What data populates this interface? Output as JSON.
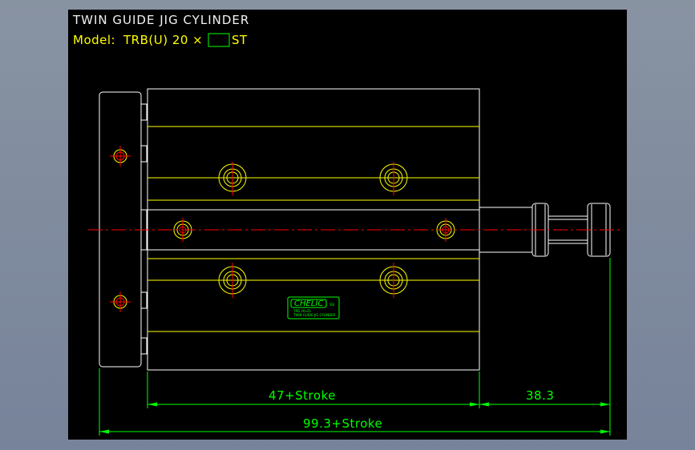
{
  "title": "TWIN GUIDE JIG CYLINDER",
  "model": {
    "label": "Model:",
    "code": "TRB(U) 20 ×",
    "suffix": "ST"
  },
  "dimensions": {
    "body_length": "47+Stroke",
    "rod_extension": "38.3",
    "overall_length": "99.3+Stroke"
  },
  "nameplate": {
    "brand": "CHELIC",
    "brand_sub": "SSI",
    "line1": "TRB 20x25",
    "line2": "TWIN GUIDE JIG CYLINDER"
  },
  "colors": {
    "background": "#000000",
    "outline": "#ffff00",
    "centerline": "#ff0000",
    "dimension": "#00ff00",
    "title": "#ffffff"
  }
}
